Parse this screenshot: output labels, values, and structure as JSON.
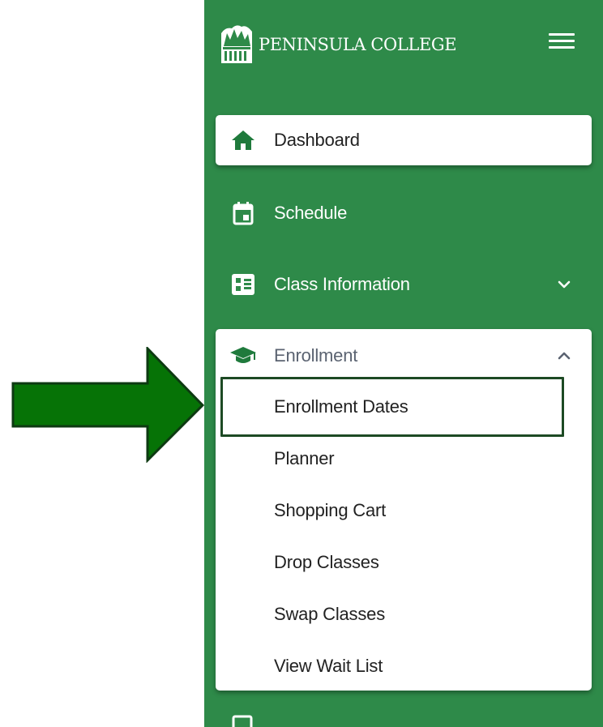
{
  "app": {
    "brand_name": "PENINSULA COLLEGE",
    "brand_logo_icon": "college-building-logo",
    "menu_icon": "hamburger-menu-icon"
  },
  "colors": {
    "sidebar_bg": "#2e8a49",
    "card_bg": "#ffffff",
    "icon_green": "#1f7a3c",
    "arrow_fill": "#067306",
    "arrow_stroke": "#0d3a12",
    "highlight_border": "#1d4a24"
  },
  "nav": {
    "dashboard": {
      "label": "Dashboard",
      "icon": "home-icon",
      "active": true
    },
    "schedule": {
      "label": "Schedule",
      "icon": "calendar-icon"
    },
    "class_information": {
      "label": "Class Information",
      "icon": "class-list-icon",
      "chevron": "chevron-down-icon"
    },
    "enrollment": {
      "label": "Enrollment",
      "icon": "graduation-cap-icon",
      "chevron": "chevron-up-icon",
      "expanded": true,
      "items": [
        {
          "label": "Enrollment Dates",
          "highlighted": true
        },
        {
          "label": "Planner"
        },
        {
          "label": "Shopping Cart"
        },
        {
          "label": "Drop Classes"
        },
        {
          "label": "Swap Classes"
        },
        {
          "label": "View Wait List"
        }
      ]
    }
  },
  "annotation": {
    "arrow": "callout-arrow-right",
    "highlight_target": "Enrollment Dates"
  }
}
